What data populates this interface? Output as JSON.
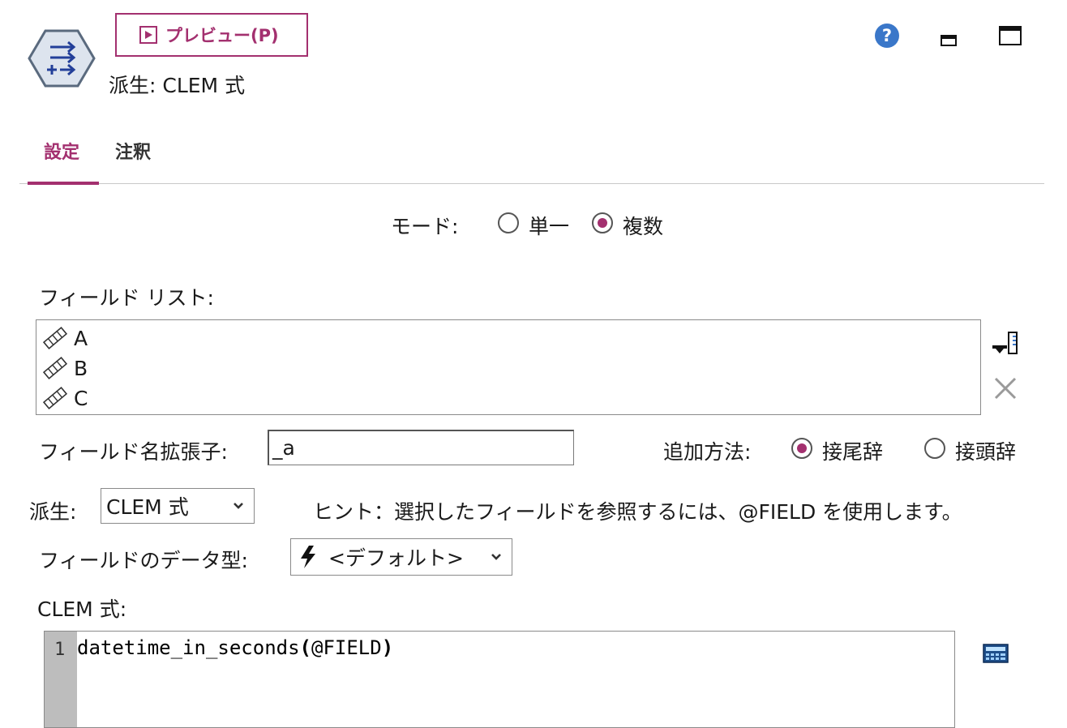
{
  "header": {
    "preview_label": "プレビュー(P)",
    "node_title": "派生: CLEM 式",
    "accent_color": "#a3306f"
  },
  "tabs": [
    {
      "label": "設定",
      "active": true
    },
    {
      "label": "注釈",
      "active": false
    }
  ],
  "mode": {
    "label": "モード:",
    "options": [
      {
        "label": "単一",
        "selected": false
      },
      {
        "label": "複数",
        "selected": true
      }
    ]
  },
  "field_list": {
    "label": "フィールド リスト:",
    "items": [
      "A",
      "B",
      "C"
    ]
  },
  "extension": {
    "label": "フィールド名拡張子:",
    "value": "_a"
  },
  "add_method": {
    "label": "追加方法:",
    "options": [
      {
        "label": "接尾辞",
        "selected": true
      },
      {
        "label": "接頭辞",
        "selected": false
      }
    ]
  },
  "derive": {
    "label": "派生:",
    "selected": "CLEM 式",
    "hint": "ヒント：選択したフィールドを参照するには、@FIELD を使用します。"
  },
  "data_type": {
    "label": "フィールドのデータ型:",
    "selected": "<デフォルト>"
  },
  "clem": {
    "label": "CLEM 式:",
    "line_number": "1",
    "code_prefix": "datetime_in_seconds",
    "code_open": "(",
    "code_arg": "@FIELD",
    "code_close": ")"
  },
  "icons": {
    "node": "derive-node-icon",
    "help": "help-icon",
    "minimize": "minimize-icon",
    "maximize": "maximize-icon",
    "field_picker": "field-picker-icon",
    "delete": "delete-icon",
    "field_type": "continuous-field-icon",
    "data_type": "default-type-icon",
    "expression_builder": "calculator-icon"
  }
}
